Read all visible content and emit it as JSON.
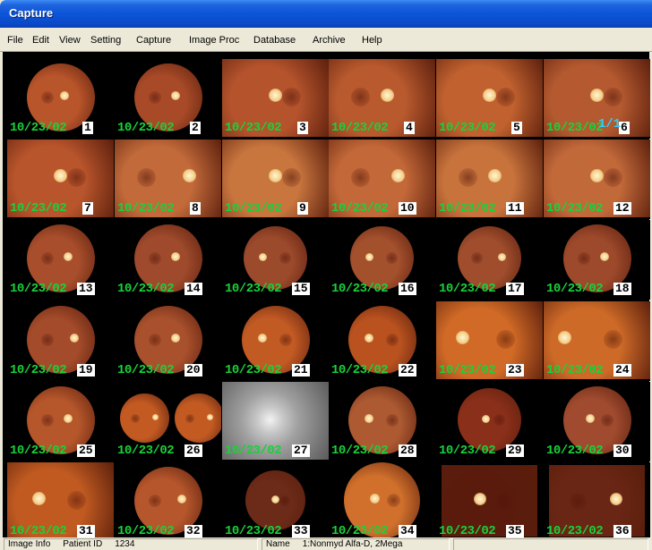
{
  "window": {
    "title": "Capture"
  },
  "menu": [
    "File",
    "Edit",
    "View",
    "Setting",
    "Capture",
    "Image Proc",
    "Database",
    "Archive",
    "Help"
  ],
  "viewer": {
    "page_indicator": "1/1",
    "thumbnails": [
      {
        "date": "10/23/02",
        "num": "1"
      },
      {
        "date": "10/23/02",
        "num": "2"
      },
      {
        "date": "10/23/02",
        "num": "3"
      },
      {
        "date": "10/23/02",
        "num": "4"
      },
      {
        "date": "10/23/02",
        "num": "5"
      },
      {
        "date": "10/23/02",
        "num": "6"
      },
      {
        "date": "10/23/02",
        "num": "7"
      },
      {
        "date": "10/23/02",
        "num": "8"
      },
      {
        "date": "10/23/02",
        "num": "9"
      },
      {
        "date": "10/23/02",
        "num": "10"
      },
      {
        "date": "10/23/02",
        "num": "11"
      },
      {
        "date": "10/23/02",
        "num": "12"
      },
      {
        "date": "10/23/02",
        "num": "13"
      },
      {
        "date": "10/23/02",
        "num": "14"
      },
      {
        "date": "10/23/02",
        "num": "15"
      },
      {
        "date": "10/23/02",
        "num": "16"
      },
      {
        "date": "10/23/02",
        "num": "17"
      },
      {
        "date": "10/23/02",
        "num": "18"
      },
      {
        "date": "10/23/02",
        "num": "19"
      },
      {
        "date": "10/23/02",
        "num": "20"
      },
      {
        "date": "10/23/02",
        "num": "21"
      },
      {
        "date": "10/23/02",
        "num": "22"
      },
      {
        "date": "10/23/02",
        "num": "23"
      },
      {
        "date": "10/23/02",
        "num": "24"
      },
      {
        "date": "10/23/02",
        "num": "25"
      },
      {
        "date": "10/23/02",
        "num": "26"
      },
      {
        "date": "10/23/02",
        "num": "27"
      },
      {
        "date": "10/23/02",
        "num": "28"
      },
      {
        "date": "10/23/02",
        "num": "29"
      },
      {
        "date": "10/23/02",
        "num": "30"
      },
      {
        "date": "10/23/02",
        "num": "31"
      },
      {
        "date": "10/23/02",
        "num": "32"
      },
      {
        "date": "10/23/02",
        "num": "33"
      },
      {
        "date": "10/23/02",
        "num": "34"
      },
      {
        "date": "10/23/02",
        "num": "35"
      },
      {
        "date": "10/23/02",
        "num": "36"
      }
    ]
  },
  "status": {
    "image_info_label": "Image Info",
    "patient_id_label": "Patient ID",
    "patient_id_value": "1234",
    "name_label": "Name",
    "name_value": "1:Nonmyd Alfa-D, 2Mega"
  },
  "colors": {
    "date_text": "#18d23a",
    "page_indicator": "#2ad2ff",
    "fundus_base": "#b8502a"
  }
}
